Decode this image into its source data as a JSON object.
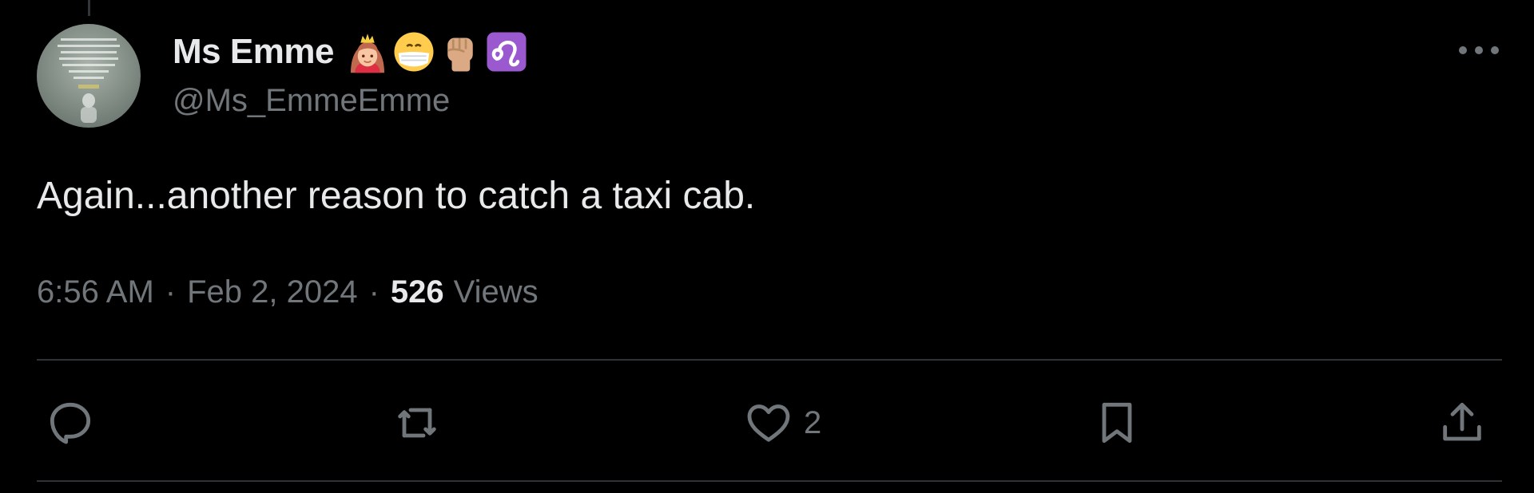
{
  "tweet": {
    "author": {
      "display_name": "Ms Emme",
      "handle": "@Ms_EmmeEmme",
      "emojis": [
        "princess-emoji",
        "face-with-medical-mask-emoji",
        "raised-fist-medium-light-skin-emoji",
        "leo-emoji"
      ]
    },
    "text": "Again...another reason to catch a taxi cab.",
    "time": "6:56 AM",
    "separator": "·",
    "date": "Feb 2, 2024",
    "views_count": "526",
    "views_label": "Views",
    "actions": {
      "reply": {
        "icon": "reply-icon"
      },
      "retweet": {
        "icon": "retweet-icon"
      },
      "like": {
        "icon": "heart-icon",
        "count": "2"
      },
      "bookmark": {
        "icon": "bookmark-icon"
      },
      "share": {
        "icon": "share-icon"
      }
    },
    "more_icon": "more-dots-icon"
  },
  "colors": {
    "background": "#000000",
    "primary_text": "#e7e9ea",
    "secondary_text": "#71767b",
    "divider": "#2f3336",
    "leo_emoji": "#9b59d0"
  }
}
